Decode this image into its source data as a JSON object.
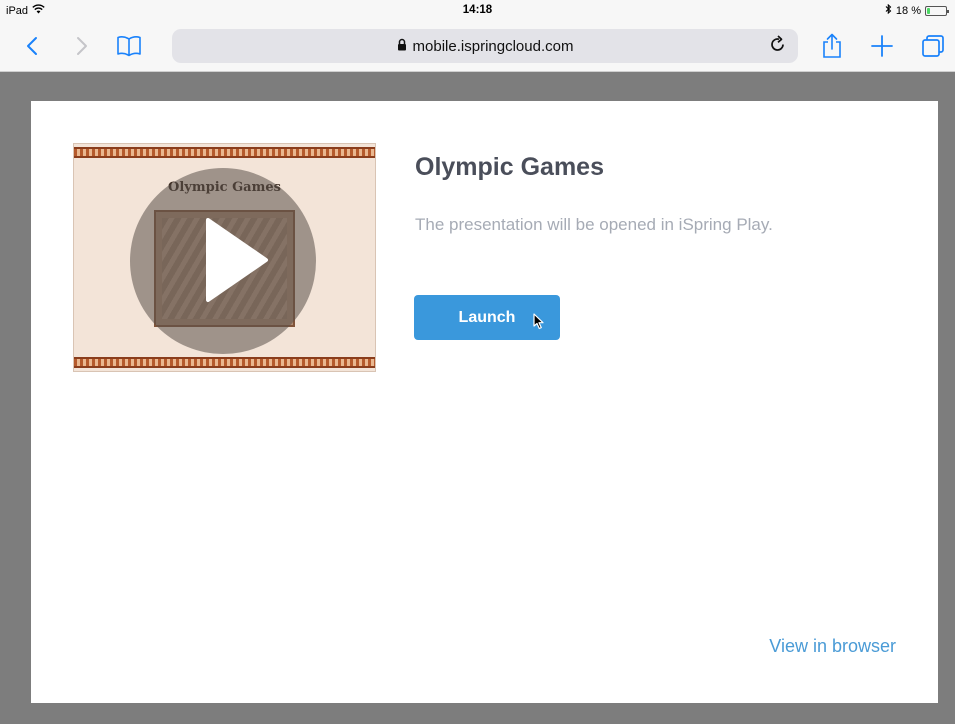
{
  "status_bar": {
    "device": "iPad",
    "time": "14:18",
    "battery_text": "18 %",
    "battery_level": 0.18
  },
  "toolbar": {
    "url": "mobile.ispringcloud.com"
  },
  "content": {
    "thumbnail_title": "Olympic Games",
    "title": "Olympic Games",
    "subtitle": "The presentation will be opened in iSpring Play.",
    "launch_label": "Launch",
    "view_in_browser": "View in browser"
  },
  "colors": {
    "accent": "#1a82fb",
    "launch_button": "#3a98dc",
    "page_background": "#7d7d7d",
    "link": "#4a9bd6"
  }
}
